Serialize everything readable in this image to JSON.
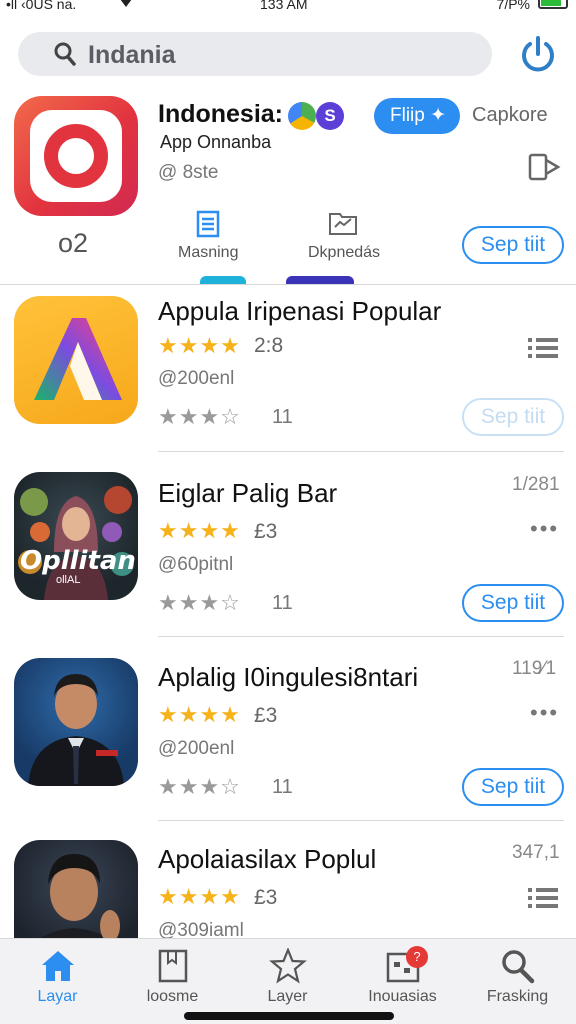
{
  "status_bar": {
    "carrier": "•ll ‹0US na.",
    "time": "133 AM",
    "battery_text": "7/P%"
  },
  "search": {
    "query": "Indania"
  },
  "featured": {
    "title": "Indonesia:",
    "badge_letter": "S",
    "subtitle": "App Onnanba",
    "meta": "@ 8ste",
    "primary_button": "Fliip",
    "secondary_label": "Capkore",
    "count": "o2",
    "tab1_label": "Masning",
    "tab2_label": "Dkpnedás",
    "get_button": "Sep tiit"
  },
  "apps": [
    {
      "name": "Appula Iripenasi Popular",
      "stars_on": 4,
      "rating": "2:8",
      "meta": "@200enl",
      "stars2_on": 3,
      "count": "11",
      "side": "",
      "action": "Sep tiit",
      "icon": "list-icon",
      "faded": true
    },
    {
      "name": "Eiglar Palig Bar",
      "stars_on": 4,
      "rating": "£3",
      "meta": "@60pitnl",
      "stars2_on": 3,
      "count": "11",
      "side": "1/281",
      "action": "Sep tiit",
      "icon": "more-icon",
      "faded": false,
      "icon_text": "Opllitan",
      "icon_sub": "ollAL"
    },
    {
      "name": "Aplalig I0ingulesi8ntari",
      "stars_on": 4,
      "rating": "£3",
      "meta": "@200enl",
      "stars2_on": 3,
      "count": "11",
      "side": "119⁄1",
      "action": "Sep tiit",
      "icon": "more-icon",
      "faded": false
    },
    {
      "name": "Apolaiasilax Poplul",
      "stars_on": 4,
      "rating": "£3",
      "meta": "@309iaml",
      "side": "347,1",
      "icon": "list-icon"
    }
  ],
  "tabs": [
    {
      "label": "Layar",
      "icon": "home-icon",
      "active": true
    },
    {
      "label": "loosme",
      "icon": "bookmark-icon",
      "active": false
    },
    {
      "label": "Layer",
      "icon": "star-icon",
      "active": false
    },
    {
      "label": "Inouasias",
      "icon": "calendar-icon",
      "active": false,
      "badge": "?"
    },
    {
      "label": "Frasking",
      "icon": "search-icon",
      "active": false
    }
  ],
  "colors": {
    "accent": "#2b8ef0",
    "star": "#f6b21b",
    "featured_icon": "#e2343f"
  }
}
